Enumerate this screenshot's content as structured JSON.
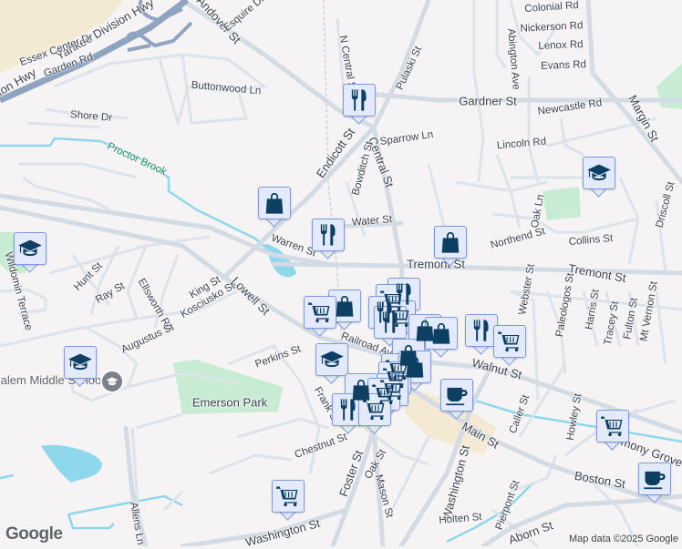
{
  "map": {
    "attribution": "Map data ©2025 Google",
    "logo": "Google",
    "colors": {
      "background": "#f5f3f4",
      "road": "#d3dbe4",
      "highway": "#8fa4c0",
      "water": "#8fd7ea",
      "park": "#c7ecd3",
      "commercial": "#f4ead3",
      "marker_icon": "#0d3f63",
      "marker_bg": "#e3eafb"
    },
    "poi_label": "Salem Middle School",
    "streets": [
      "Colonial Rd",
      "Nickerson Rd",
      "Lenox Rd",
      "Evans Rd",
      "Gardner St",
      "Newcastle Rd",
      "Lincoln Rd",
      "Margin St",
      "Abington Ave",
      "Pulaski St",
      "Central St",
      "Sparrow Ln",
      "Bowditch St",
      "Endicott St",
      "N Central St",
      "Andover St",
      "Esquire Dr",
      "Yankee Division Hwy",
      "Essex Center Dr",
      "Garden Rd",
      "Buttonwood Ln",
      "Shore Dr",
      "Proctor Brook",
      "Water St",
      "Warren St",
      "Tremont St",
      "Tremont St",
      "Northend St",
      "Collins St",
      "Oak Ln",
      "Driscoll St",
      "Webster St",
      "Paleologos St",
      "Harris St",
      "Tracey St",
      "Fulton St",
      "Mt Vernon St",
      "Lowell St",
      "Kosciusko St",
      "King St",
      "Ellsworth Rd",
      "Ray St",
      "Hunt St",
      "Augustus St",
      "Perkins St",
      "Railroad Ave",
      "Walnut St",
      "Emerson Park",
      "Caller St",
      "Main St",
      "Howley St",
      "Harmony Grove",
      "Boston St",
      "Chestnut St",
      "Foster St",
      "Oak St",
      "Mason St",
      "Washington St",
      "Holten St",
      "Pierpont St",
      "Aborn St",
      "Washington St",
      "Allens Ln",
      "Wildomin Terrace",
      "ton Hwy",
      "Frank St"
    ],
    "markers": [
      {
        "icon": "restaurant"
      },
      {
        "icon": "shopping"
      },
      {
        "icon": "restaurant"
      },
      {
        "icon": "shopping"
      },
      {
        "icon": "school"
      },
      {
        "icon": "school"
      },
      {
        "icon": "school"
      },
      {
        "icon": "restaurant"
      },
      {
        "icon": "cart"
      },
      {
        "icon": "restaurant"
      },
      {
        "icon": "cart"
      },
      {
        "icon": "shopping"
      },
      {
        "icon": "cart"
      },
      {
        "icon": "restaurant"
      },
      {
        "icon": "shopping"
      },
      {
        "icon": "shopping"
      },
      {
        "icon": "restaurant"
      },
      {
        "icon": "cart"
      },
      {
        "icon": "school"
      },
      {
        "icon": "shopping"
      },
      {
        "icon": "cart"
      },
      {
        "icon": "shopping"
      },
      {
        "icon": "cart"
      },
      {
        "icon": "cart"
      },
      {
        "icon": "shopping"
      },
      {
        "icon": "cart"
      },
      {
        "icon": "restaurant"
      },
      {
        "icon": "cart"
      },
      {
        "icon": "coffee"
      },
      {
        "icon": "cart"
      },
      {
        "icon": "coffee"
      },
      {
        "icon": "cart"
      }
    ]
  }
}
